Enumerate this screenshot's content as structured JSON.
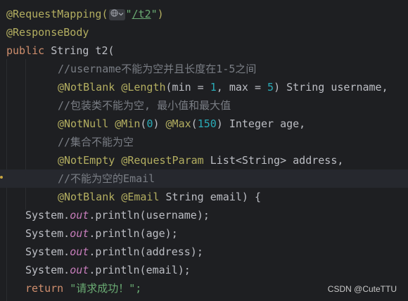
{
  "code": {
    "l1_ann": "@RequestMapping(",
    "l1_str_open": "\"",
    "l1_path": "/t2",
    "l1_str_close": "\"",
    "l1_close": ")",
    "l2_ann": "@ResponseBody",
    "l3_kw": "public",
    "l3_rest": " String t2(",
    "l4_cmt": "//username不能为空并且长度在1-5之间",
    "l5_ann1": "@NotBlank",
    "l5_ann2": "@Length",
    "l5_a": "(min = ",
    "l5_n1": "1",
    "l5_b": ", max = ",
    "l5_n2": "5",
    "l5_c": ") String username,",
    "l6_cmt": "//包装类不能为空, 最小值和最大值",
    "l7_ann1": "@NotNull",
    "l7_ann2": "@Min",
    "l7_a": "(",
    "l7_n1": "0",
    "l7_b": ") ",
    "l7_ann3": "@Max",
    "l7_c": "(",
    "l7_n2": "150",
    "l7_d": ") Integer age,",
    "l8_cmt": "//集合不能为空",
    "l9_ann1": "@NotEmpty",
    "l9_ann2": "@RequestParam",
    "l9_rest": " List<String> address,",
    "l10_cmt": "//不能为空的Email",
    "l11_ann1": "@NotBlank",
    "l11_ann2": "@Email",
    "l11_rest": " String email) {",
    "sys": "System.",
    "out": "out",
    "l12_rest": ".println(username);",
    "l13_rest": ".println(age);",
    "l14_rest": ".println(address);",
    "l15_rest": ".println(email);",
    "l16_kw": "return",
    "l16_str": "\"请求成功！\";"
  },
  "inlay_icons": [
    "globe-icon",
    "chevron-down-icon"
  ],
  "watermark": "CSDN @CuteTTU",
  "colors": {
    "background": "#1e1f22",
    "annotation": "#b3ae60",
    "keyword": "#cf8e6d",
    "string": "#6aab73",
    "number": "#2aacb8",
    "comment": "#7a7e85",
    "field": "#c77dbb",
    "text": "#bcbec4"
  }
}
